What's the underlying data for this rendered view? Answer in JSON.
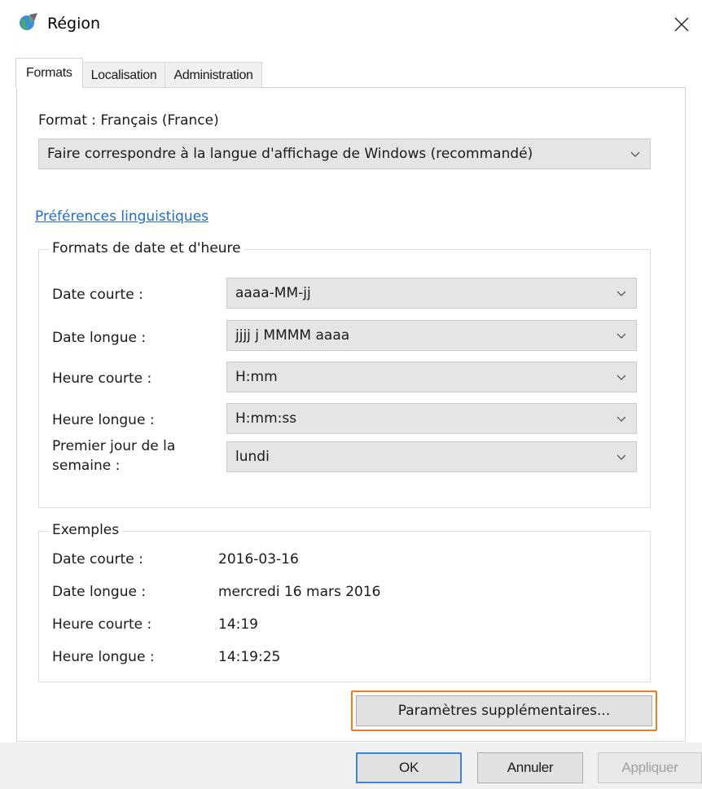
{
  "window": {
    "title": "Région"
  },
  "tabs": [
    {
      "label": "Formats",
      "active": true
    },
    {
      "label": "Localisation",
      "active": false
    },
    {
      "label": "Administration",
      "active": false
    }
  ],
  "formats": {
    "format_label": "Format : Français (France)",
    "format_value": "Faire correspondre à la langue d'affichage de Windows (recommandé)",
    "language_link": "Préférences linguistiques",
    "date_time_group": {
      "title": "Formats de date et d'heure",
      "rows": [
        {
          "label": "Date courte :",
          "value": "aaaa-MM-jj"
        },
        {
          "label": "Date longue :",
          "value": "jjjj j MMMM aaaa"
        },
        {
          "label": "Heure courte :",
          "value": "H:mm"
        },
        {
          "label": "Heure longue :",
          "value": "H:mm:ss"
        },
        {
          "label_line1": "Premier jour de la",
          "label_line2": "semaine :",
          "value": "lundi"
        }
      ]
    },
    "examples_group": {
      "title": "Exemples",
      "rows": [
        {
          "label": "Date courte :",
          "value": "2016-03-16"
        },
        {
          "label": "Date longue :",
          "value": "mercredi 16 mars 2016"
        },
        {
          "label": "Heure courte :",
          "value": "14:19"
        },
        {
          "label": "Heure longue :",
          "value": "14:19:25"
        }
      ]
    },
    "additional_settings_label": "Paramètres supplémentaires..."
  },
  "footer": {
    "ok_label": "OK",
    "cancel_label": "Annuler",
    "apply_label": "Appliquer",
    "apply_enabled": false
  },
  "colors": {
    "link": "#1e6ec8",
    "highlight": "#f07c1e",
    "ok_focus": "#3a86d6"
  }
}
